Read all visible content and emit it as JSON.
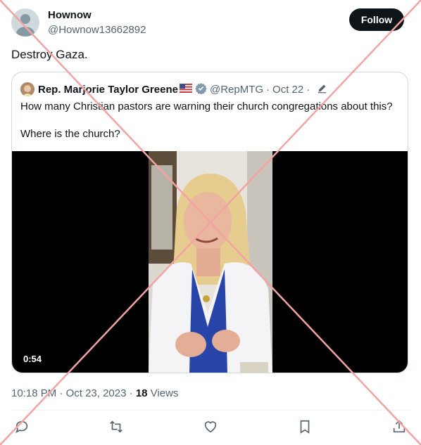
{
  "author": {
    "name": "Hownow",
    "handle": "@Hownow13662892"
  },
  "follow_label": "Follow",
  "post_text": "Destroy Gaza.",
  "quote": {
    "name": "Rep. Marjorie Taylor Greene",
    "handle": "@RepMTG",
    "dot": "·",
    "date": "Oct 22",
    "line1": "How many Christian pastors are warning their church congregations about this?",
    "line2": "Where is the church?",
    "video_duration": "0:54"
  },
  "meta": {
    "time": "10:18 PM",
    "sep": "·",
    "date": "Oct 23, 2023",
    "views_count": "18",
    "views_label": "Views"
  },
  "icons": {
    "reply": "speech-bubble",
    "repost": "two-arrows-loop",
    "like": "heart",
    "bookmark": "bookmark",
    "share": "upload-arrow",
    "verified": "badge-check",
    "edit": "pencil",
    "flag": "us-flag"
  },
  "colors": {
    "text": "#0f1419",
    "secondary": "#536471",
    "verified": "#829aab",
    "follow_bg": "#0f1419",
    "cross_overlay": "#f4a3a3"
  }
}
